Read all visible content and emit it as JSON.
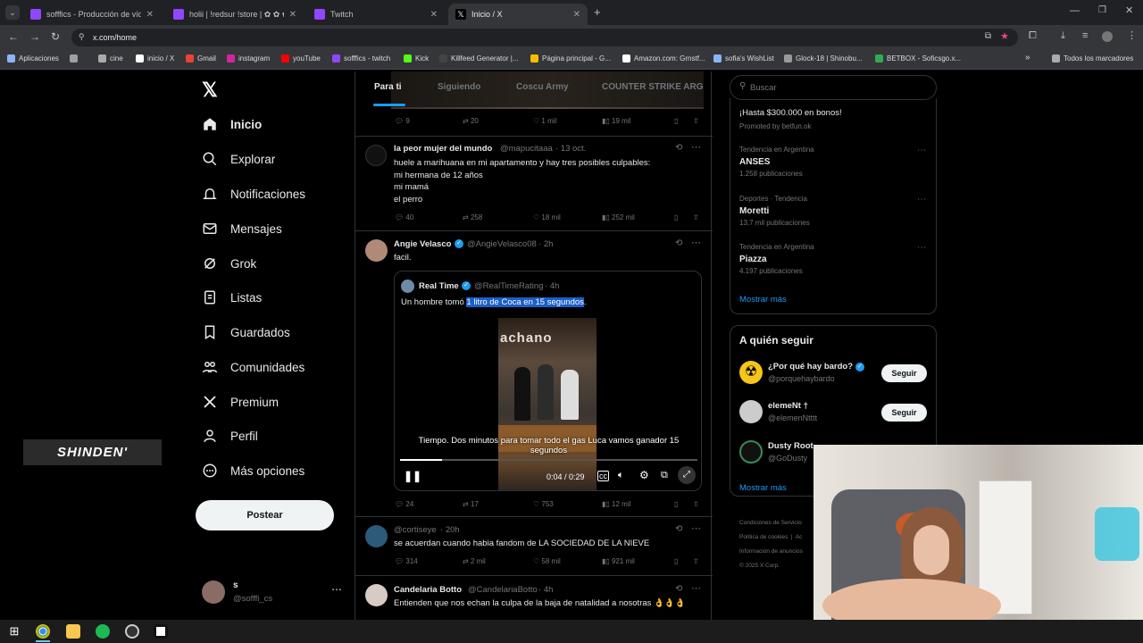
{
  "browser": {
    "tabs": [
      {
        "title": "sofffics - Producción de vídeo",
        "active": false
      },
      {
        "title": "holii | !redsur !store | ✿ ✿ ✿ s",
        "active": false
      },
      {
        "title": "Twitch",
        "active": false
      },
      {
        "title": "Inicio / X",
        "active": true
      }
    ],
    "url": "x.com/home",
    "bookmarks": [
      "Aplicaciones",
      "cine",
      "inicio / X",
      "Gmail",
      "instagram",
      "youTube",
      "sofffics - twitch",
      "Kick",
      "Killfeed Generator |...",
      "Página principal - G...",
      "Amazon.com: Grnstf...",
      "sofia's WishList",
      "Glock-18 | Shinobu...",
      "BETBOX - Soficsgo.x...",
      "Todos los marcadores"
    ]
  },
  "nav": {
    "items": [
      "Inicio",
      "Explorar",
      "Notificaciones",
      "Mensajes",
      "Grok",
      "Listas",
      "Guardados",
      "Comunidades",
      "Premium",
      "Perfil",
      "Más opciones"
    ],
    "post_button": "Postear",
    "account_name": "s",
    "account_handle": "@sofffi_cs"
  },
  "overlay_logo": "SHINDEN'",
  "timeline": {
    "tabs": [
      "Para ti",
      "Siguiendo",
      "Coscu Army",
      "COUNTER STRIKE ARG"
    ],
    "top_actions": {
      "replies": "9",
      "reposts": "20",
      "likes": "1 mil",
      "views": "19 mil"
    },
    "posts": [
      {
        "name": "la peor mujer del mundo",
        "handle": "@mapucitaaa",
        "time": "13 oct.",
        "lines": [
          "huele a marihuana en mi apartamento y hay tres posibles culpables:",
          "mi hermana de 12 años",
          "mi mamá",
          "el perro"
        ],
        "replies": "40",
        "reposts": "258",
        "likes": "18 mil",
        "views": "252 mil"
      },
      {
        "name": "Angie Velasco",
        "handle": "@AngieVelasco08",
        "time": "2h",
        "text": "facil.",
        "quote": {
          "name": "Real Time",
          "handle": "@RealTimeRating",
          "time": "4h",
          "text_before": "Un hombre tomó ",
          "text_highlight": "1 litro de Coca en 15 segundos",
          "text_after": ".",
          "video_sign": "achano",
          "caption": "Tiempo. Dos minutos para tomar todo el gas Luca vamos ganador 15 segundos",
          "time_display": "0:04 / 0:29",
          "progress": 0.14
        },
        "replies": "24",
        "reposts": "17",
        "likes": "753",
        "views": "12 mil"
      },
      {
        "name": "",
        "handle": "@cortiseye",
        "time": "20h",
        "text": "se acuerdan cuando habia fandom de LA SOCIEDAD DE LA NIEVE",
        "replies": "314",
        "reposts": "2 mil",
        "likes": "58 mil",
        "views": "921 mil"
      },
      {
        "name": "Candelaria Botto",
        "handle": "@CandelariaBotto",
        "time": "4h",
        "text": "Entienden que nos echan la culpa de la baja de natalidad a nosotras 👌👌👌"
      }
    ]
  },
  "sidebar": {
    "search_placeholder": "Buscar",
    "promo": {
      "text": "¡Hasta $300.000 en bonos!",
      "by": "Promoted by betfun.ok"
    },
    "trends": [
      {
        "context": "Tendencia en Argentina",
        "name": "ANSES",
        "count": "1.258 publicaciones"
      },
      {
        "context": "Deportes · Tendencia",
        "name": "Moretti",
        "count": "13,7 mil publicaciones"
      },
      {
        "context": "Tendencia en Argentina",
        "name": "Piazza",
        "count": "4.197 publicaciones"
      }
    ],
    "show_more": "Mostrar más",
    "who_to_follow_title": "A quién seguir",
    "follow": [
      {
        "name": "¿Por qué hay bardo?",
        "handle": "@porquehaybardo",
        "button": "Seguir"
      },
      {
        "name": "elemeNt †",
        "handle": "@elemenNtttt",
        "button": "Seguir"
      },
      {
        "name": "Dusty Root",
        "handle": "@GoDusty"
      }
    ],
    "show_more_2": "Mostrar más",
    "footer": [
      "Condiciones de Servicio",
      "Política de cookies",
      "Ac",
      "Información de anuncios",
      "© 2025 X Corp."
    ]
  },
  "colors": {
    "accent": "#1d9bf0",
    "background": "#000000",
    "border": "#2f3336",
    "muted": "#71767b",
    "text": "#e7e9ea"
  }
}
